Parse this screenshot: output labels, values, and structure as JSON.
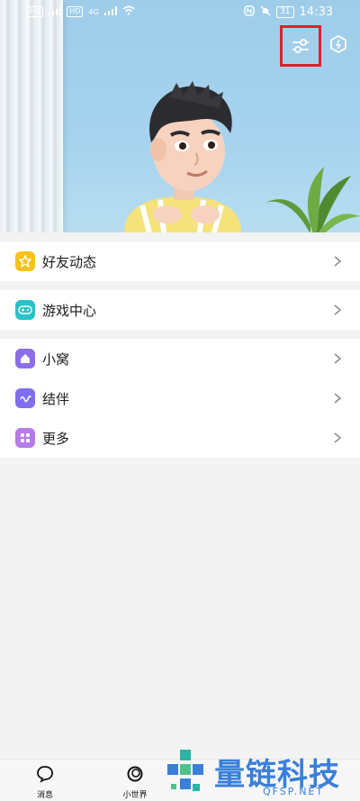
{
  "status_bar": {
    "left_badges": [
      "HD",
      "HD"
    ],
    "network": "4G",
    "battery": "31",
    "time": "14:33"
  },
  "header": {
    "filter_icon": "sliders-icon",
    "hex_icon": "hexagon-icon"
  },
  "menu": {
    "group1": [
      {
        "label": "好友动态",
        "icon": "star-icon",
        "color": "#f5c21b"
      }
    ],
    "group2": [
      {
        "label": "游戏中心",
        "icon": "gamepad-icon",
        "color": "#27c3c6"
      }
    ],
    "group3": [
      {
        "label": "小窝",
        "icon": "home-icon",
        "color": "#8b6ee8"
      },
      {
        "label": "结伴",
        "icon": "wave-icon",
        "color": "#7f6ff0"
      },
      {
        "label": "更多",
        "icon": "grid-icon",
        "color": "#b57be8"
      }
    ]
  },
  "tabbar": {
    "tabs": [
      {
        "label": "消息",
        "icon": "chat-bubble-icon"
      },
      {
        "label": "小世界",
        "icon": "circle-world-icon"
      }
    ]
  },
  "watermark": {
    "text": "量链科技",
    "url": "QFSP.NET"
  }
}
